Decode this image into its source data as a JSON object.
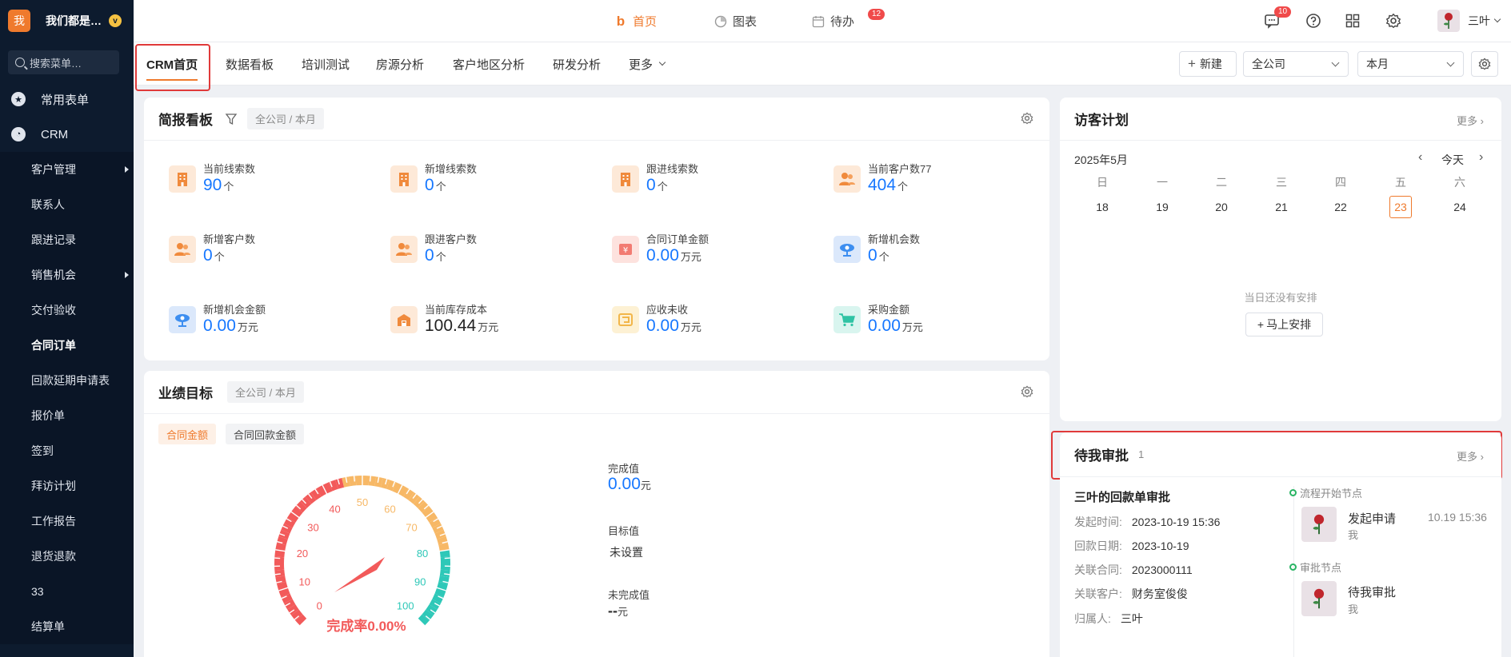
{
  "sidebar": {
    "logo": "我",
    "org_name": "我们都是…",
    "org_badge": "v",
    "search_placeholder": "搜索菜单…",
    "groups": [
      {
        "label": "常用表单",
        "icon": "star-icon"
      },
      {
        "label": "CRM",
        "icon": "pie-icon"
      }
    ],
    "items": [
      {
        "label": "客户管理",
        "has_sub": true
      },
      {
        "label": "联系人"
      },
      {
        "label": "跟进记录"
      },
      {
        "label": "销售机会",
        "has_sub": true
      },
      {
        "label": "交付验收"
      },
      {
        "label": "合同订单"
      },
      {
        "label": "回款延期申请表"
      },
      {
        "label": "报价单"
      },
      {
        "label": "签到"
      },
      {
        "label": "拜访计划"
      },
      {
        "label": "工作报告"
      },
      {
        "label": "退货退款"
      },
      {
        "label": "33"
      },
      {
        "label": "结算单"
      }
    ]
  },
  "topnav": {
    "home": "首页",
    "home_icon": "b",
    "chart": "图表",
    "todo": "待办",
    "todo_badge": "12",
    "msg_badge": "10",
    "user": "三叶"
  },
  "tabs": [
    "CRM首页",
    "数据看板",
    "培训测试",
    "房源分析",
    "客户地区分析",
    "研发分析",
    "更多"
  ],
  "toolbar": {
    "new_label": "新建",
    "company_select": "全公司",
    "period_select": "本月"
  },
  "briefing": {
    "title": "简报看板",
    "scope": "全公司 / 本月",
    "stats": [
      {
        "label": "当前线索数",
        "value": "90",
        "unit": "个",
        "icon": "building-icon",
        "color": "orange"
      },
      {
        "label": "新增线索数",
        "value": "0",
        "unit": "个",
        "icon": "building-icon",
        "color": "orange"
      },
      {
        "label": "跟进线索数",
        "value": "0",
        "unit": "个",
        "icon": "building-icon",
        "color": "orange"
      },
      {
        "label": "当前客户数77",
        "value": "404",
        "unit": "个",
        "icon": "people-icon",
        "color": "orange"
      },
      {
        "label": "新增客户数",
        "value": "0",
        "unit": "个",
        "icon": "people-icon",
        "color": "orange"
      },
      {
        "label": "跟进客户数",
        "value": "0",
        "unit": "个",
        "icon": "people-icon",
        "color": "orange"
      },
      {
        "label": "合同订单金额",
        "value": "0.00",
        "unit": "万元",
        "icon": "yen-icon",
        "color": "pink"
      },
      {
        "label": "新增机会数",
        "value": "0",
        "unit": "个",
        "icon": "opportunity-icon",
        "color": "blue"
      },
      {
        "label": "新增机会金额",
        "value": "0.00",
        "unit": "万元",
        "icon": "opportunity-icon",
        "color": "blue"
      },
      {
        "label": "当前库存成本",
        "value": "100.44",
        "unit": "万元",
        "icon": "warehouse-icon",
        "color": "orange"
      },
      {
        "label": "应收未收",
        "value": "0.00",
        "unit": "万元",
        "icon": "receivable-icon",
        "color": "yellow"
      },
      {
        "label": "采购金额",
        "value": "0.00",
        "unit": "万元",
        "icon": "cart-icon",
        "color": "teal"
      }
    ]
  },
  "performance": {
    "title": "业绩目标",
    "scope": "全公司 / 本月",
    "subtabs": [
      "合同金额",
      "合同回款金额"
    ],
    "gauge_ticks": [
      "0",
      "10",
      "20",
      "30",
      "40",
      "50",
      "60",
      "70",
      "80",
      "90",
      "100"
    ],
    "completion_rate": 0.0,
    "completion_text": "完成率0.00%",
    "done_label": "完成值",
    "done_value": "0.00",
    "done_unit": "元",
    "target_label": "目标值",
    "target_value": "未设置",
    "remaining_label": "未完成值",
    "remaining_value": "--",
    "remaining_unit": "元"
  },
  "visit_plan": {
    "title": "访客计划",
    "more": "更多",
    "month": "2025年5月",
    "today_label": "今天",
    "weekdays": [
      "日",
      "一",
      "二",
      "三",
      "四",
      "五",
      "六"
    ],
    "days": [
      "18",
      "19",
      "20",
      "21",
      "22",
      "23",
      "24"
    ],
    "today_index": 5,
    "empty_text": "当日还没有安排",
    "arrange_button": "马上安排"
  },
  "approval": {
    "title": "待我审批",
    "count": "1",
    "more": "更多",
    "item_title": "三叶的回款单审批",
    "fields": [
      {
        "key": "发起时间:",
        "value": "2023-10-19 15:36"
      },
      {
        "key": "回款日期:",
        "value": "2023-10-19"
      },
      {
        "key": "关联合同:",
        "value": "2023000111"
      },
      {
        "key": "关联客户:",
        "value": "财务室俊俊"
      },
      {
        "key": "归属人:",
        "value": "三叶"
      }
    ],
    "flow": [
      {
        "node": "流程开始节点",
        "action": "发起申请",
        "who": "我",
        "time": "10.19 15:36"
      },
      {
        "node": "审批节点",
        "action": "待我审批",
        "who": "我",
        "time": ""
      }
    ]
  },
  "colors": {
    "accent": "#ef7a2d",
    "link_blue": "#1677ff",
    "sidebar_bg": "#0d1b2e",
    "highlight_red": "#e03a3a"
  }
}
